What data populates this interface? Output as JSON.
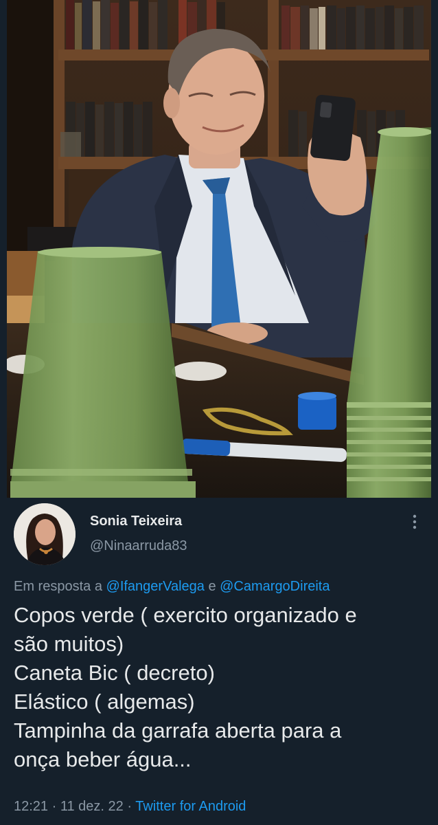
{
  "tweet": {
    "display_name": "Sonia Teixeira",
    "handle": "@Ninaarruda83",
    "reply_prefix": "Em resposta a",
    "reply_mentions": [
      "@IfangerValega",
      "@CamargoDireita"
    ],
    "reply_joiner": "e",
    "text_lines": [
      "Copos verde ( exercito organizado e",
      "são muitos)",
      "Caneta Bic ( decreto)",
      "Elástico ( algemas)",
      "Tampinha da garrafa aberta para a",
      "onça beber água..."
    ],
    "time": "12:21",
    "date": "11 dez. 22",
    "separator": "·",
    "source": "Twitter for Android"
  },
  "colors": {
    "background": "#15202b",
    "text_primary": "#e7e9ea",
    "text_secondary": "#8b98a5",
    "link": "#1d9bf0"
  },
  "icons": {
    "more": "more-vertical-icon"
  }
}
